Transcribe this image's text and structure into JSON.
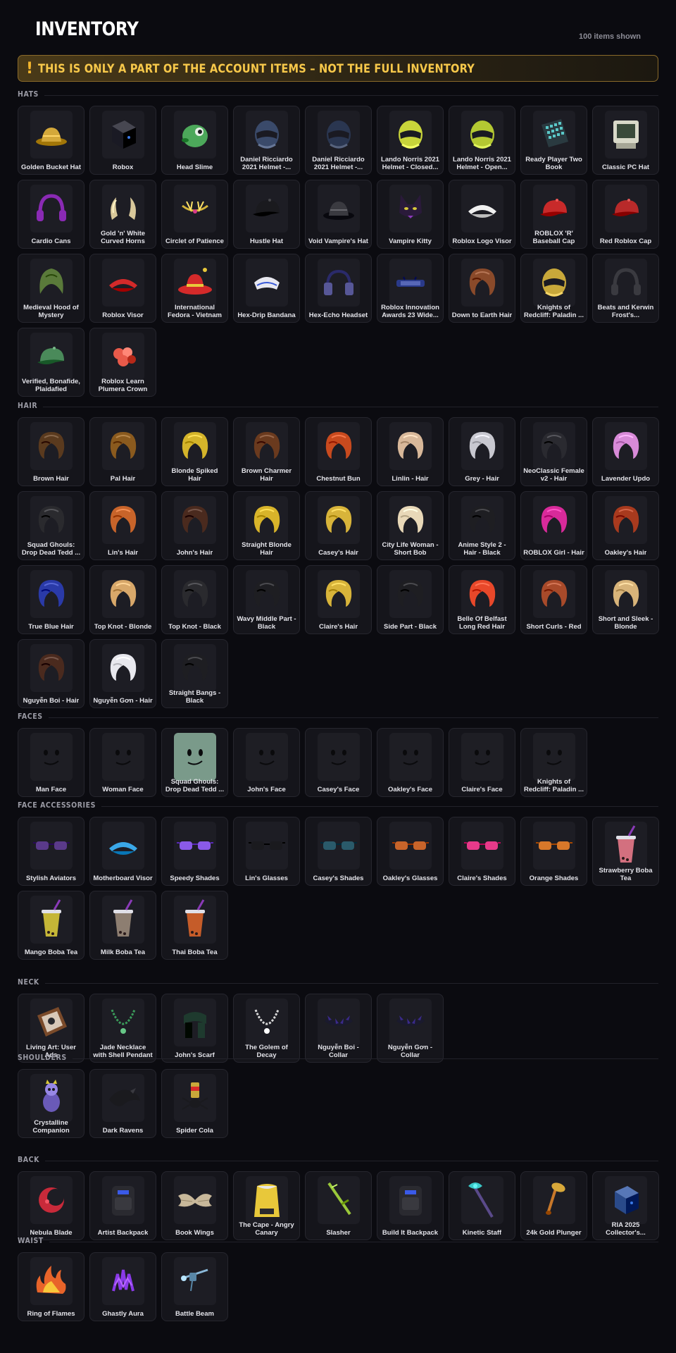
{
  "header": {
    "title": "INVENTORY",
    "count": "100 items shown"
  },
  "banner": {
    "icon": "!",
    "text": "THIS IS ONLY A PART OF THE ACCOUNT ITEMS – NOT THE FULL INVENTORY"
  },
  "sections": [
    {
      "label": "HATS",
      "items": [
        {
          "name": "Golden Bucket Hat",
          "icon": "hat-icon",
          "color": "#d4a83a"
        },
        {
          "name": "Robox",
          "icon": "box-icon",
          "color": "#1a1a24"
        },
        {
          "name": "Head Slime",
          "icon": "slime-icon",
          "color": "#4ca85a"
        },
        {
          "name": "Daniel Ricciardo 2021 Helmet -...",
          "icon": "helmet-icon",
          "color": "#3a4a6a"
        },
        {
          "name": "Daniel Ricciardo 2021 Helmet -...",
          "icon": "helmet-icon",
          "color": "#2a3650"
        },
        {
          "name": "Lando Norris 2021 Helmet - Closed...",
          "icon": "helmet-icon",
          "color": "#c8d43a"
        },
        {
          "name": "Lando Norris 2021 Helmet - Open...",
          "icon": "helmet-icon",
          "color": "#b4c832"
        },
        {
          "name": "Ready Player Two Book",
          "icon": "book-icon",
          "color": "#5ac8c8"
        },
        {
          "name": "Classic PC Hat",
          "icon": "computer-icon",
          "color": "#d8d8c8"
        },
        {
          "name": "Cardio Cans",
          "icon": "headphones-icon",
          "color": "#8a2ab4"
        },
        {
          "name": "Gold 'n' White Curved Horns",
          "icon": "horns-icon",
          "color": "#d8c89a"
        },
        {
          "name": "Circlet of Patience",
          "icon": "circlet-icon",
          "color": "#d4b43a"
        },
        {
          "name": "Hustle Hat",
          "icon": "cap-icon",
          "color": "#1a1a1e"
        },
        {
          "name": "Void Vampire's Hat",
          "icon": "hat-icon",
          "color": "#3a3a40"
        },
        {
          "name": "Vampire Kitty",
          "icon": "cat-ears-icon",
          "color": "#2a1a3a"
        },
        {
          "name": "Roblox Logo Visor",
          "icon": "visor-icon",
          "color": "#f0f0f0"
        },
        {
          "name": "ROBLOX 'R' Baseball Cap",
          "icon": "cap-icon",
          "color": "#c82a2a"
        },
        {
          "name": "Red Roblox Cap",
          "icon": "cap-icon",
          "color": "#b82a2a"
        },
        {
          "name": "Medieval Hood of Mystery",
          "icon": "hood-icon",
          "color": "#5a7a3a"
        },
        {
          "name": "Roblox Visor",
          "icon": "visor-icon",
          "color": "#d42a2a"
        },
        {
          "name": "International Fedora - Vietnam",
          "icon": "fedora-icon",
          "color": "#d42a2a"
        },
        {
          "name": "Hex-Drip Bandana",
          "icon": "bandana-icon",
          "color": "#e8e8f0"
        },
        {
          "name": "Hex-Echo Headset",
          "icon": "headset-icon",
          "color": "#2a2a6a"
        },
        {
          "name": "Roblox Innovation Awards 23 Wide...",
          "icon": "headband-icon",
          "color": "#2a3a8a"
        },
        {
          "name": "Down to Earth Hair",
          "icon": "hair-icon",
          "color": "#8a4a2a"
        },
        {
          "name": "Knights of Redcliff: Paladin ...",
          "icon": "helmet-icon",
          "color": "#c8a83a"
        },
        {
          "name": "Beats and Kerwin Frost's...",
          "icon": "headphones-icon",
          "color": "#3a3a40"
        },
        {
          "name": "Verified, Bonafide, Plaidafied",
          "icon": "cap-icon",
          "color": "#4a8a5a"
        },
        {
          "name": "Roblox Learn Plumera Crown",
          "icon": "flower-icon",
          "color": "#e85a4a"
        }
      ]
    },
    {
      "label": "HAIR",
      "items": [
        {
          "name": "Brown Hair",
          "icon": "hair-icon",
          "color": "#5a3a1e"
        },
        {
          "name": "Pal Hair",
          "icon": "hair-icon",
          "color": "#8a5a1e"
        },
        {
          "name": "Blonde Spiked Hair",
          "icon": "hair-icon",
          "color": "#d4b42a"
        },
        {
          "name": "Brown Charmer Hair",
          "icon": "hair-icon",
          "color": "#6a3a1e"
        },
        {
          "name": "Chestnut Bun",
          "icon": "hair-icon",
          "color": "#c84a1e"
        },
        {
          "name": "Linlin - Hair",
          "icon": "hair-icon",
          "color": "#d8b89a"
        },
        {
          "name": "Grey - Hair",
          "icon": "hair-icon",
          "color": "#c8c8d0"
        },
        {
          "name": "NeoClassic Female v2 - Hair",
          "icon": "hair-icon",
          "color": "#2a2a30"
        },
        {
          "name": "Lavender Updo",
          "icon": "hair-icon",
          "color": "#d88ad8"
        },
        {
          "name": "Squad Ghouls: Drop Dead Tedd ...",
          "icon": "hair-icon",
          "color": "#2a2a2e"
        },
        {
          "name": "Lin's Hair",
          "icon": "hair-icon",
          "color": "#c8642a"
        },
        {
          "name": "John's Hair",
          "icon": "hair-icon",
          "color": "#4a2a1e"
        },
        {
          "name": "Straight Blonde Hair",
          "icon": "hair-icon",
          "color": "#d8b42a"
        },
        {
          "name": "Casey's Hair",
          "icon": "hair-icon",
          "color": "#d8b43a"
        },
        {
          "name": "City Life Woman - Short Bob",
          "icon": "hair-icon",
          "color": "#e8d8b8"
        },
        {
          "name": "Anime Style 2 - Hair - Black",
          "icon": "hair-icon",
          "color": "#1e1e22"
        },
        {
          "name": "ROBLOX Girl - Hair",
          "icon": "hair-icon",
          "color": "#d82a9a"
        },
        {
          "name": "Oakley's Hair",
          "icon": "hair-icon",
          "color": "#a83a1e"
        },
        {
          "name": "True Blue Hair",
          "icon": "hair-icon",
          "color": "#2a3aa8"
        },
        {
          "name": "Top Knot - Blonde",
          "icon": "hair-icon",
          "color": "#d8a86a"
        },
        {
          "name": "Top Knot - Black",
          "icon": "hair-icon",
          "color": "#2a2a2e"
        },
        {
          "name": "Wavy Middle Part - Black",
          "icon": "hair-icon",
          "color": "#1e1e22"
        },
        {
          "name": "Claire's Hair",
          "icon": "hair-icon",
          "color": "#d8b43a"
        },
        {
          "name": "Side Part - Black",
          "icon": "hair-icon",
          "color": "#1e1e22"
        },
        {
          "name": "Belle Of Belfast Long Red Hair",
          "icon": "hair-icon",
          "color": "#e8482a"
        },
        {
          "name": "Short Curls - Red",
          "icon": "hair-icon",
          "color": "#a84a2a"
        },
        {
          "name": "Short and Sleek - Blonde",
          "icon": "hair-icon",
          "color": "#d8b47a"
        },
        {
          "name": "Nguyễn Boi - Hair",
          "icon": "hair-icon",
          "color": "#4a2a1e"
        },
        {
          "name": "Nguyễn Gơn - Hair",
          "icon": "hair-icon",
          "color": "#e8e8ee"
        },
        {
          "name": "Straight Bangs - Black",
          "icon": "hair-icon",
          "color": "#1e1e22"
        }
      ]
    },
    {
      "label": "FACES",
      "items": [
        {
          "name": "Man Face",
          "icon": "face-icon",
          "color": "#1e1e24"
        },
        {
          "name": "Woman Face",
          "icon": "face-icon",
          "color": "#1e1e24"
        },
        {
          "name": "Squad Ghouls: Drop Dead Tedd ...",
          "icon": "face-icon",
          "color": "#7a9a8a"
        },
        {
          "name": "John's Face",
          "icon": "face-icon",
          "color": "#1e1e24"
        },
        {
          "name": "Casey's Face",
          "icon": "face-icon",
          "color": "#1e1e24"
        },
        {
          "name": "Oakley's Face",
          "icon": "face-icon",
          "color": "#1e1e24"
        },
        {
          "name": "Claire's Face",
          "icon": "face-icon",
          "color": "#1e1e24"
        },
        {
          "name": "Knights of Redcliff: Paladin ...",
          "icon": "face-icon",
          "color": "#1e1e24"
        }
      ]
    },
    {
      "label": "FACE ACCESSORIES",
      "items": [
        {
          "name": "Stylish Aviators",
          "icon": "glasses-icon",
          "color": "#5a3a8a"
        },
        {
          "name": "Motherboard Visor",
          "icon": "visor-icon",
          "color": "#3aa8e8"
        },
        {
          "name": "Speedy Shades",
          "icon": "glasses-icon",
          "color": "#8a5ae8"
        },
        {
          "name": "Lin's Glasses",
          "icon": "glasses-icon",
          "color": "#1a1a1e"
        },
        {
          "name": "Casey's Shades",
          "icon": "glasses-icon",
          "color": "#2a5a6a"
        },
        {
          "name": "Oakley's Glasses",
          "icon": "glasses-icon",
          "color": "#c8642a"
        },
        {
          "name": "Claire's Shades",
          "icon": "glasses-icon",
          "color": "#e83a8a"
        },
        {
          "name": "Orange Shades",
          "icon": "glasses-icon",
          "color": "#d8782a"
        },
        {
          "name": "Strawberry Boba Tea",
          "icon": "boba-icon",
          "color": "#e87a8a"
        },
        {
          "name": "Mango Boba Tea",
          "icon": "boba-icon",
          "color": "#d8c83a"
        },
        {
          "name": "Milk Boba Tea",
          "icon": "boba-icon",
          "color": "#9a8a7a"
        },
        {
          "name": "Thai Boba Tea",
          "icon": "boba-icon",
          "color": "#d8642a"
        }
      ]
    },
    {
      "label": "NECK",
      "items": [
        {
          "name": "Living Art: User Ads",
          "icon": "frame-icon",
          "color": "#d8c8b8"
        },
        {
          "name": "Jade Necklace with Shell Pendant",
          "icon": "necklace-icon",
          "color": "#3a9a5a"
        },
        {
          "name": "John's Scarf",
          "icon": "scarf-icon",
          "color": "#1e3a2e"
        },
        {
          "name": "The Golem of Decay",
          "icon": "necklace-icon",
          "color": "#d8d8d8"
        },
        {
          "name": "Nguyễn Boi - Collar",
          "icon": "collar-icon",
          "color": "#3a2a8a"
        },
        {
          "name": "Nguyễn Gơn - Collar",
          "icon": "collar-icon",
          "color": "#3a2a8a"
        }
      ]
    },
    {
      "label": "SHOULDERS",
      "items": [
        {
          "name": "Crystalline Companion",
          "icon": "pet-icon",
          "color": "#6a5ab8"
        },
        {
          "name": "Dark Ravens",
          "icon": "raven-icon",
          "color": "#1a1a1e"
        },
        {
          "name": "Spider Cola",
          "icon": "spider-icon",
          "color": "#c8a83a"
        }
      ]
    },
    {
      "label": "BACK",
      "items": [
        {
          "name": "Nebula Blade",
          "icon": "blade-icon",
          "color": "#c82a3a"
        },
        {
          "name": "Artist Backpack",
          "icon": "backpack-icon",
          "color": "#2a2a30"
        },
        {
          "name": "Book Wings",
          "icon": "wings-icon",
          "color": "#c8b89a"
        },
        {
          "name": "The Cape - Angry Canary",
          "icon": "cape-icon",
          "color": "#e8c83a"
        },
        {
          "name": "Slasher",
          "icon": "sword-icon",
          "color": "#9ac83a"
        },
        {
          "name": "Build It Backpack",
          "icon": "backpack-icon",
          "color": "#2a2a30"
        },
        {
          "name": "Kinetic Staff",
          "icon": "staff-icon",
          "color": "#3ac8c8"
        },
        {
          "name": "24k Gold Plunger",
          "icon": "plunger-icon",
          "color": "#c8782a"
        },
        {
          "name": "RIA 2025 Collector's...",
          "icon": "box-icon",
          "color": "#2a4a8a"
        }
      ]
    },
    {
      "label": "WAIST",
      "items": [
        {
          "name": "Ring of Flames",
          "icon": "flame-icon",
          "color": "#e8642a"
        },
        {
          "name": "Ghastly Aura",
          "icon": "aura-icon",
          "color": "#8a3ae8"
        },
        {
          "name": "Battle Beam",
          "icon": "beam-icon",
          "color": "#8ab8d8"
        }
      ]
    }
  ]
}
